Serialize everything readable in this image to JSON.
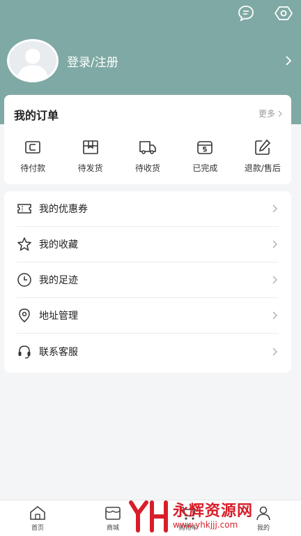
{
  "header": {
    "login_text": "登录/注册"
  },
  "orders": {
    "title": "我的订单",
    "more": "更多",
    "items": [
      {
        "label": "待付款",
        "icon": "wallet-icon"
      },
      {
        "label": "待发货",
        "icon": "package-icon"
      },
      {
        "label": "待收货",
        "icon": "truck-icon"
      },
      {
        "label": "已完成",
        "icon": "box-done-icon"
      },
      {
        "label": "退款/售后",
        "icon": "edit-icon"
      }
    ]
  },
  "menu": {
    "items": [
      {
        "label": "我的优惠券",
        "icon": "coupon-icon"
      },
      {
        "label": "我的收藏",
        "icon": "star-icon"
      },
      {
        "label": "我的足迹",
        "icon": "clock-icon"
      },
      {
        "label": "地址管理",
        "icon": "location-icon"
      },
      {
        "label": "联系客服",
        "icon": "headset-icon"
      }
    ]
  },
  "tabbar": {
    "items": [
      {
        "label": "首页",
        "icon": "home-icon"
      },
      {
        "label": "商城",
        "icon": "store-icon"
      },
      {
        "label": "购物车",
        "icon": "cart-icon"
      },
      {
        "label": "我的",
        "icon": "user-icon"
      }
    ]
  },
  "watermark": {
    "title": "永辉资源网",
    "url": "www.yhkjjj.com"
  },
  "colors": {
    "header_bg": "#7fa9a4",
    "watermark": "#d81e2a"
  }
}
